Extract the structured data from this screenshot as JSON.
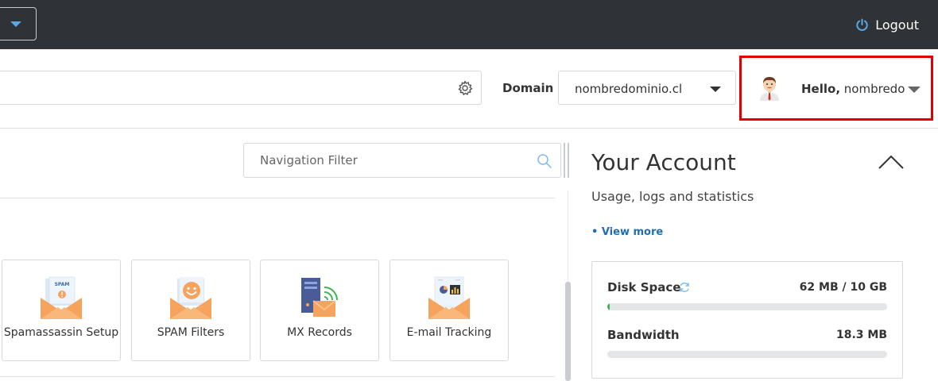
{
  "topbar": {
    "logout_label": "Logout"
  },
  "header": {
    "domain_label": "Domain",
    "domain_value": "nombredominio.cl",
    "user_greeting": "Hello,",
    "user_name": "nombredo"
  },
  "content": {
    "nav_filter_placeholder": "Navigation Filter",
    "tools": [
      {
        "label": "Spamassassin Setup",
        "icon": "spam-envelope-icon"
      },
      {
        "label": "SPAM Filters",
        "icon": "smiley-envelope-icon"
      },
      {
        "label": "MX Records",
        "icon": "server-mail-icon"
      },
      {
        "label": "E-mail Tracking",
        "icon": "chart-envelope-icon"
      }
    ]
  },
  "account": {
    "title": "Your Account",
    "subtitle": "Usage, logs and statistics",
    "view_more": "• View more",
    "stats": [
      {
        "label": "Disk Space",
        "value": "62 MB / 10 GB",
        "fraction": 0.006
      },
      {
        "label": "Bandwidth",
        "value": "18.3 MB",
        "fraction": 0
      }
    ]
  },
  "icons": {
    "tile_spam_label": "SPAM"
  },
  "colors": {
    "topbar": "#2f3236",
    "accent_blue": "#5aa9e6",
    "link": "#1f6fb2",
    "highlight_border": "#e00000",
    "progress_fill": "#3fb34f"
  }
}
